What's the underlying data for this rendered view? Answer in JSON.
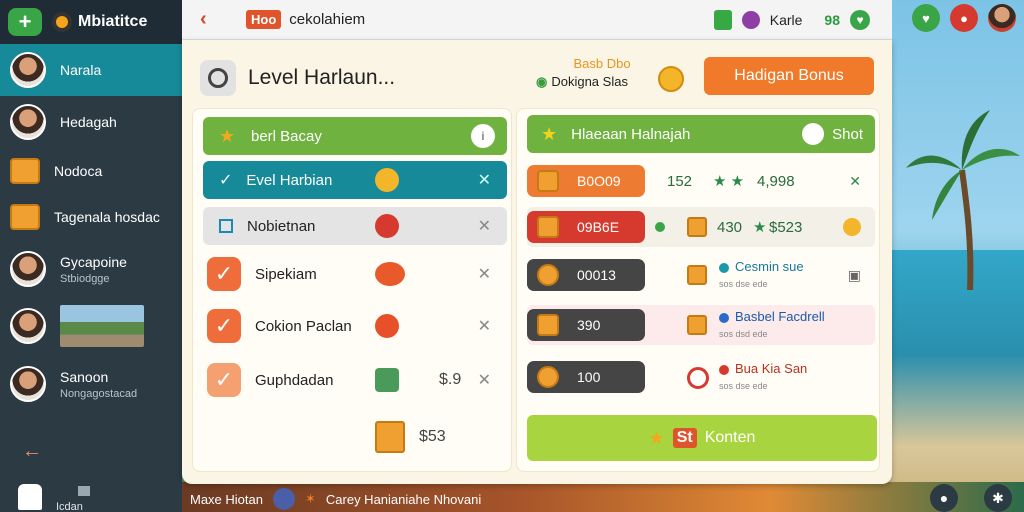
{
  "sidebar": {
    "logo": "Mbiatitce",
    "items": [
      {
        "label": "Narala",
        "sub": ""
      },
      {
        "label": "Hedagah",
        "sub": ""
      },
      {
        "label": "Nodoca",
        "sub": ""
      },
      {
        "label": "Tagenala hosdac",
        "sub": ""
      },
      {
        "label": "Gycapoine",
        "sub": "Stbiodgge"
      },
      {
        "label": "",
        "sub": ""
      },
      {
        "label": "Sanoon",
        "sub": "Nongagostacad"
      }
    ],
    "bottom_text": "Icdan"
  },
  "topbar": {
    "badge": "Hoo",
    "title": "cekolahiem",
    "user": "Karle",
    "count": "98"
  },
  "panel": {
    "title": "Level Harlaun...",
    "bonus_line1": "Basb Dbo",
    "bonus_line2": "Dokigna Slas",
    "bonus_button": "Hadigan Bonus"
  },
  "left_list": [
    {
      "label": "berl Bacay",
      "value": ""
    },
    {
      "label": "Evel Harbian",
      "value": ""
    },
    {
      "label": "Nobietnan",
      "value": ""
    },
    {
      "label": "Sipekiam",
      "value": ""
    },
    {
      "label": "Cokion Paclan",
      "value": ""
    },
    {
      "label": "Guphdadan",
      "value": "$.9"
    }
  ],
  "left_total": "$53",
  "right_header": {
    "label": "Hlaeaan Halnajah",
    "button": "Shot"
  },
  "right_rows": [
    {
      "pill": "B0O09",
      "a": "152",
      "b": "4,998",
      "name": "",
      "sub": ""
    },
    {
      "pill": "09B6E",
      "a": "430",
      "b": "$523",
      "name": "",
      "sub": ""
    },
    {
      "pill": "00013",
      "a": "",
      "b": "",
      "name": "Cesmin sue",
      "sub": "sos dse ede"
    },
    {
      "pill": "390",
      "a": "",
      "b": "",
      "name": "Basbel Facdrell",
      "sub": "sos dsd ede"
    },
    {
      "pill": "100",
      "a": "",
      "b": "",
      "name": "Bua Kia San",
      "sub": "sos dse ede"
    }
  ],
  "konten": {
    "badge": "St",
    "label": "Konten"
  },
  "bottombar": {
    "left": "Maxe Hiotan",
    "right": "Carey Hanianiahe Nhovani"
  },
  "colors": {
    "accent_green": "#6fb23f",
    "teal": "#178a99",
    "orange": "#f07a2a",
    "sidebar": "#2c3a44"
  }
}
